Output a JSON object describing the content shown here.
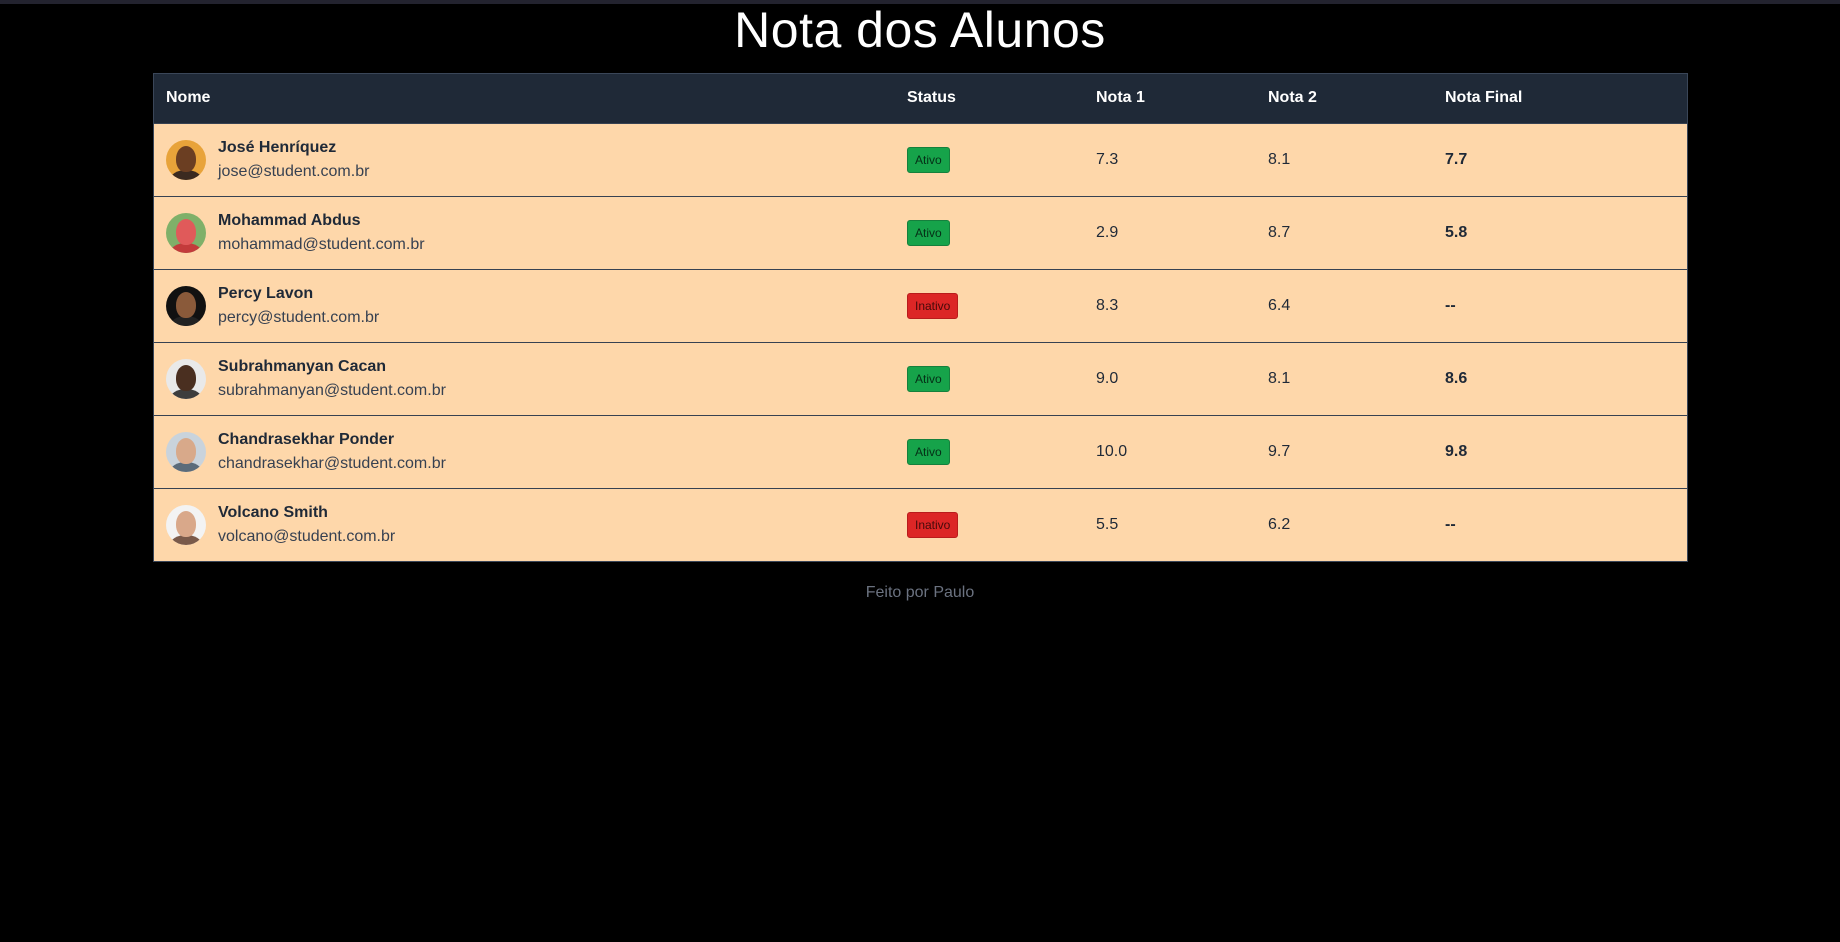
{
  "page": {
    "title": "Nota dos Alunos",
    "footer": "Feito por Paulo"
  },
  "table": {
    "headers": {
      "name": "Nome",
      "status": "Status",
      "nota1": "Nota 1",
      "nota2": "Nota 2",
      "final": "Nota Final"
    },
    "rows": [
      {
        "name": "José Henríquez",
        "email": "jose@student.com.br",
        "status": "Ativo",
        "nota1": "7.3",
        "nota2": "8.1",
        "final": "7.7",
        "avatar_bg": "#e8a33a",
        "avatar_face": "#6b3e22",
        "avatar_body": "#3b2a20"
      },
      {
        "name": "Mohammad Abdus",
        "email": "mohammad@student.com.br",
        "status": "Ativo",
        "nota1": "2.9",
        "nota2": "8.7",
        "final": "5.8",
        "avatar_bg": "#7fb069",
        "avatar_face": "#e05a5a",
        "avatar_body": "#c33b3b"
      },
      {
        "name": "Percy Lavon",
        "email": "percy@student.com.br",
        "status": "Inativo",
        "nota1": "8.3",
        "nota2": "6.4",
        "final": "--",
        "avatar_bg": "#111111",
        "avatar_face": "#8a5a3a",
        "avatar_body": "#222222"
      },
      {
        "name": "Subrahmanyan Cacan",
        "email": "subrahmanyan@student.com.br",
        "status": "Ativo",
        "nota1": "9.0",
        "nota2": "8.1",
        "final": "8.6",
        "avatar_bg": "#e9e9e9",
        "avatar_face": "#4a2f20",
        "avatar_body": "#3d3d3d"
      },
      {
        "name": "Chandrasekhar Ponder",
        "email": "chandrasekhar@student.com.br",
        "status": "Ativo",
        "nota1": "10.0",
        "nota2": "9.7",
        "final": "9.8",
        "avatar_bg": "#c9d3dc",
        "avatar_face": "#d8a98a",
        "avatar_body": "#5b6b7a"
      },
      {
        "name": "Volcano Smith",
        "email": "volcano@student.com.br",
        "status": "Inativo",
        "nota1": "5.5",
        "nota2": "6.2",
        "final": "--",
        "avatar_bg": "#f3f3f3",
        "avatar_face": "#d9a88a",
        "avatar_body": "#7a5a4a"
      }
    ]
  },
  "colors": {
    "background": "#000000",
    "header_bg": "#1f2937",
    "row_bg": "#fed7aa",
    "ativo": "#16a34a",
    "inativo": "#dc2626"
  }
}
